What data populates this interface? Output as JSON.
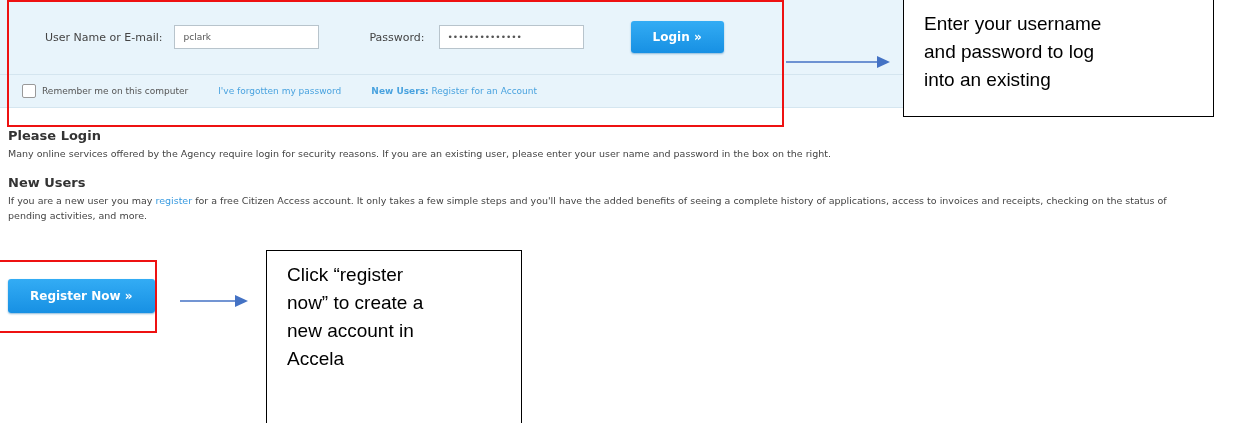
{
  "login_panel": {
    "username_label": "User Name or E-mail:",
    "username_value": "pclark",
    "password_label": "Password:",
    "password_value": "••••••••••••••",
    "login_button": "Login »",
    "remember": {
      "label": "Remember me on this computer",
      "checked": false
    },
    "forgot_link": "I've forgotten my password",
    "register_link": "**New Users:** Register for an Account"
  },
  "sections": [
    {
      "heading": "Please Login",
      "parts": [
        {
          "kind": "text",
          "text": "Many online services offered by the Agency require login for security reasons. If you are an existing user, please enter your user name and password in the box on the right."
        }
      ]
    },
    {
      "heading": "New Users",
      "parts": [
        {
          "kind": "text",
          "text": "If you are a new user you may "
        },
        {
          "kind": "link",
          "text": "register"
        },
        {
          "kind": "text",
          "text": " for a free Citizen Access account. It only takes a few simple steps and you'll have the added benefits of seeing a complete history of applications, access to invoices and receipts, checking on the status of pending activities, and more."
        }
      ]
    }
  ],
  "register_button": "Register Now »",
  "callouts": [
    {
      "lines": [
        "Enter your username",
        "and password to log",
        "into an existing"
      ]
    },
    {
      "lines": [
        "Click “register",
        "now” to create a",
        "new account in",
        "Accela"
      ]
    }
  ]
}
